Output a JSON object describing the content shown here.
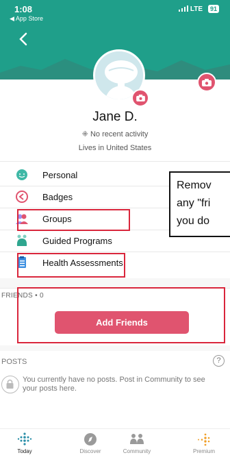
{
  "status_bar": {
    "time": "1:08",
    "back_app": "◀ App Store",
    "network": "LTE",
    "battery": "91"
  },
  "profile": {
    "name": "Jane D.",
    "activity": "No recent activity",
    "location": "Lives in United States"
  },
  "menu": [
    {
      "label": "Personal"
    },
    {
      "label": "Badges"
    },
    {
      "label": "Groups"
    },
    {
      "label": "Guided Programs"
    },
    {
      "label": "Health Assessments"
    }
  ],
  "annotation": {
    "lines": [
      "Remov",
      "any \"fri",
      "you do"
    ]
  },
  "friends": {
    "label": "FRIENDS • 0",
    "button": "Add Friends"
  },
  "posts": {
    "label": "POSTS",
    "help": "?",
    "empty_text": "You currently have no posts. Post in Community to see your posts here."
  },
  "tabs": [
    {
      "label": "Today"
    },
    {
      "label": "Discover"
    },
    {
      "label": "Community"
    },
    {
      "label": "Premium"
    }
  ],
  "colors": {
    "header": "#1f9f8a",
    "accent": "#e0546f",
    "highlight": "#d9253b"
  }
}
